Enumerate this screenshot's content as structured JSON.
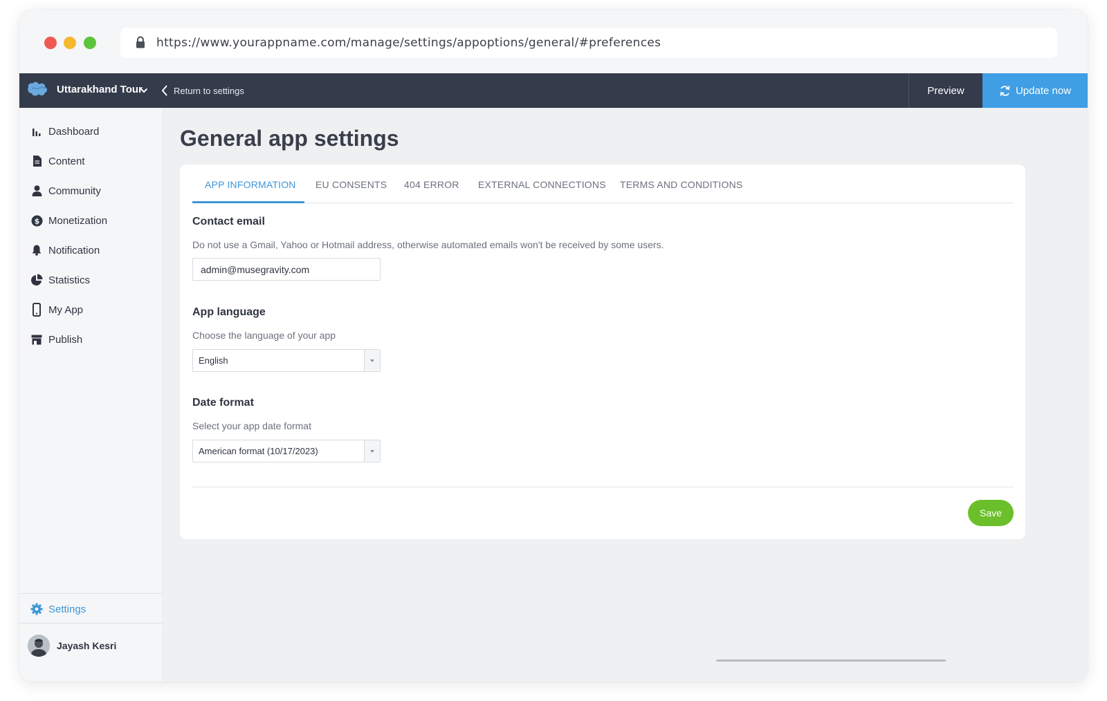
{
  "browser": {
    "url": "https://www.yourappname.com/manage/settings/appoptions/general/#preferences"
  },
  "topbar": {
    "app_name": "Uttarakhand Tour",
    "return_label": "Return to settings",
    "preview_label": "Preview",
    "update_label": "Update now",
    "accent_color": "#3f9ee4"
  },
  "sidebar": {
    "items": [
      {
        "label": "Dashboard",
        "icon": "bar-chart-icon"
      },
      {
        "label": "Content",
        "icon": "document-icon"
      },
      {
        "label": "Community",
        "icon": "user-icon"
      },
      {
        "label": "Monetization",
        "icon": "dollar-icon"
      },
      {
        "label": "Notification",
        "icon": "bell-icon"
      },
      {
        "label": "Statistics",
        "icon": "pie-chart-icon"
      },
      {
        "label": "My App",
        "icon": "phone-icon"
      },
      {
        "label": "Publish",
        "icon": "store-icon"
      }
    ],
    "settings_label": "Settings",
    "user_name": "Jayash Kesri"
  },
  "main": {
    "title": "General app settings",
    "tabs": [
      {
        "label": "APP INFORMATION",
        "active": true
      },
      {
        "label": "EU CONSENTS",
        "active": false
      },
      {
        "label": "404 ERROR",
        "active": false
      },
      {
        "label": "EXTERNAL CONNECTIONS",
        "active": false
      },
      {
        "label": "TERMS AND CONDITIONS",
        "active": false
      }
    ],
    "contact_email": {
      "title": "Contact email",
      "description": "Do not use a Gmail, Yahoo or Hotmail address, otherwise automated emails won't be received by some users.",
      "value": "admin@musegravity.com"
    },
    "app_language": {
      "title": "App language",
      "description": "Choose the language of your app",
      "selected": "English"
    },
    "date_format": {
      "title": "Date format",
      "description": "Select your app date format",
      "selected": "American format (10/17/2023)"
    },
    "save_label": "Save",
    "save_color": "#6bbf2a"
  }
}
